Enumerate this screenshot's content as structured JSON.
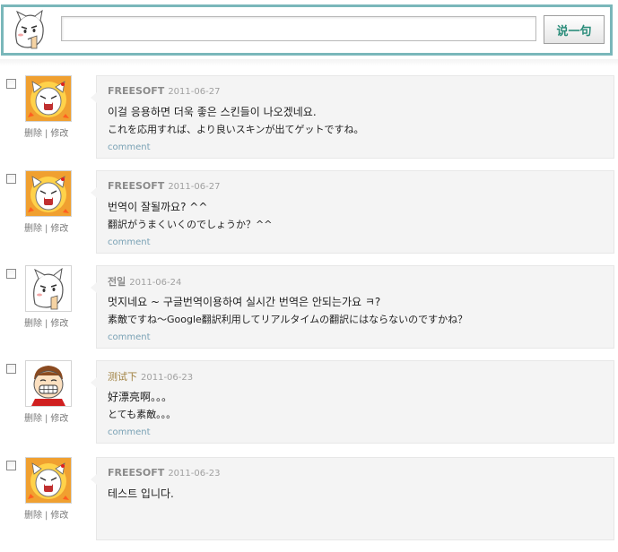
{
  "post_box": {
    "textarea_value": "",
    "submit_label": "说一句"
  },
  "entries": [
    {
      "author": "FREESOFT",
      "date": "2011-06-27",
      "line1": "이걸 응용하면 더욱 좋은 스킨들이 나오겠네요.",
      "line2": "これを応用すれば、より良いスキンが出てゲットですね。",
      "avatar": "angry-cat-avatar",
      "delete_label": "删除",
      "edit_label": "修改",
      "comment_label": "comment"
    },
    {
      "author": "FREESOFT",
      "date": "2011-06-27",
      "line1": "번역이 잘될까요? ^^",
      "line2": "翻訳がうまくいくのでしょうか？^^",
      "avatar": "angry-cat-avatar",
      "delete_label": "删除",
      "edit_label": "修改",
      "comment_label": "comment"
    },
    {
      "author": "전일",
      "date": "2011-06-24",
      "line1": "멋지네요 ~ 구글번역이용하여 실시간 번역은 안되는가요 ㅋ?",
      "line2": "素敵ですね～Google翻訳利用してリアルタイムの翻訳にはならないのですかね？",
      "avatar": "thinking-face-avatar",
      "delete_label": "删除",
      "edit_label": "修改",
      "comment_label": "comment"
    },
    {
      "author": "测试下",
      "date": "2011-06-23",
      "line1": "好漂亮啊。。。",
      "line2": "とても素敵。。。",
      "avatar": "grinning-face-avatar",
      "delete_label": "删除",
      "edit_label": "修改",
      "comment_label": "comment"
    },
    {
      "author": "FREESOFT",
      "date": "2011-06-23",
      "line1": "테스트 입니다.",
      "line2": "",
      "avatar": "angry-cat-avatar",
      "delete_label": "删除",
      "edit_label": "修改",
      "comment_label": "comment"
    }
  ],
  "colors": {
    "post_border": "#7ab7ba",
    "bubble_bg": "#f4f4f4",
    "comment_link": "#7aa2b5",
    "button_text": "#2a8c7a"
  }
}
